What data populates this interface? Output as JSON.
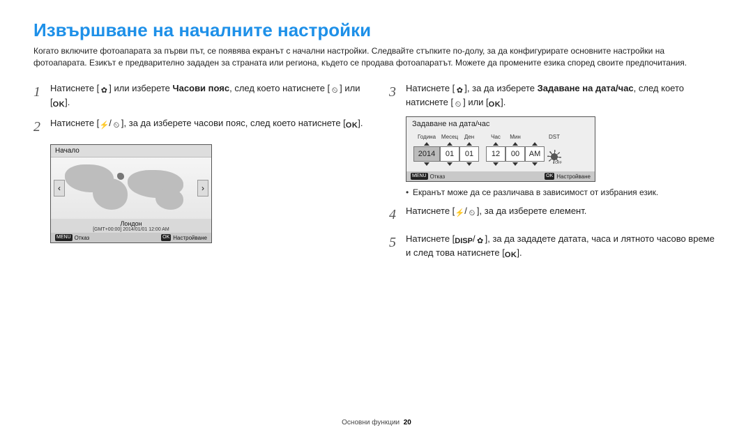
{
  "title": "Извършване на началните настройки",
  "intro": "Когато включите фотоапарата за първи път, се появява екранът с начални настройки. Следвайте стъпките по-долу, за да конфигурирате основните настройки на фотоапарата. Езикът е предварително зададен за страната или региона, където се продава фотоапаратът. Можете да промените езика според своите предпочитания.",
  "icons": {
    "flower": "✿",
    "timer": "⏲",
    "flash": "⚡",
    "ok": "OK",
    "menu": "MENU",
    "disp": "DISP"
  },
  "steps_left": {
    "s1a": "Натиснете [",
    "s1b": "] или изберете ",
    "s1c": "Часови пояс",
    "s1d": ", след което натиснете [",
    "s1e": "] или [",
    "s1f": "].",
    "s2a": "Натиснете [",
    "s2b": "/",
    "s2c": "], за да изберете часови пояс, след което натиснете [",
    "s2d": "]."
  },
  "steps_right": {
    "s3a": "Натиснете [",
    "s3b": "], за да изберете ",
    "s3c": "Задаване на дата/час",
    "s3d": ", след което натиснете [",
    "s3e": "] или [",
    "s3f": "].",
    "s4a": "Натиснете [",
    "s4b": "/",
    "s4c": "], за да изберете елемент.",
    "s5a": "Натиснете [",
    "s5b": "/",
    "s5c": "], за да зададете датата, часа и лятното часово време и след това натиснете [",
    "s5d": "]."
  },
  "lcd_map": {
    "title": "Начало",
    "city": "Лондон",
    "gmt": "[GMT+00:00] 2014/01/01 12:00 AM",
    "cancel": "Отказ",
    "set": "Настройване"
  },
  "lcd_date": {
    "title": "Задаване на дата/час",
    "labels": {
      "year": "Година",
      "month": "Месец",
      "day": "Ден",
      "hour": "Час",
      "min": "Мин",
      "dst": "DST"
    },
    "values": {
      "year": "2014",
      "month": "01",
      "day": "01",
      "hour": "12",
      "min": "00",
      "ampm": "AM"
    },
    "cancel": "Отказ",
    "set": "Настройване"
  },
  "note": "Екранът може да се различава в зависимост от избрания език.",
  "footer": {
    "section": "Основни функции",
    "page": "20"
  }
}
